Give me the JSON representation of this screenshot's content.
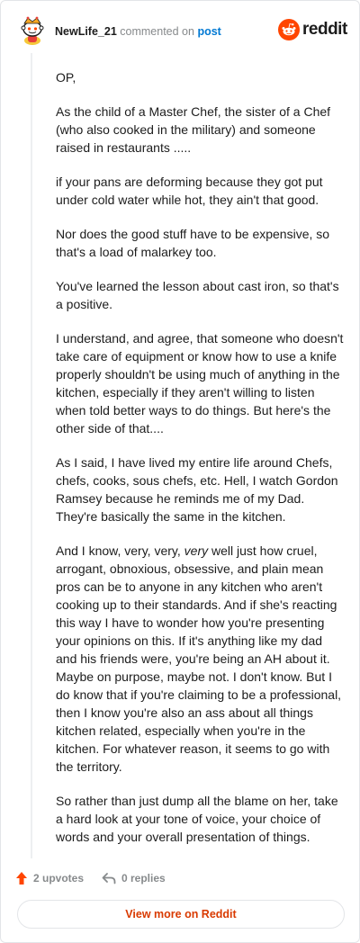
{
  "header": {
    "username": "NewLife_21",
    "commented_text": "commented on",
    "post_link": "post",
    "brand_name": "reddit",
    "avatar_icon": "snoo-avatar-icon",
    "brand_icon": "reddit-logo-icon"
  },
  "comment": {
    "paragraphs": [
      "OP,",
      "As the child of a Master Chef, the sister of a Chef (who also cooked in the military) and someone raised in restaurants .....",
      "if your pans are deforming because they got put under cold water while hot, they ain't that good.",
      "Nor does the good stuff have to be expensive, so that's a load of malarkey too.",
      "You've learned the lesson about cast iron, so that's a positive.",
      "I understand, and agree, that someone who doesn't take care of equipment or know how to use a knife properly shouldn't be using much of anything in the kitchen, especially if they aren't willing to listen when told better ways to do things. But here's the other side of that....",
      "As I said, I have lived my entire life around Chefs, chefs, cooks, sous chefs, etc. Hell, I watch Gordon Ramsey because he reminds me of my Dad. They're basically the same in the kitchen.",
      "So rather than just dump all the blame on her, take a hard look at your tone of voice, your choice of words and your overall presentation of things."
    ],
    "paragraph_8": {
      "before": "And I know, very, very, ",
      "emphasis": "very",
      "after": " well just how cruel, arrogant, obnoxious, obsessive, and plain mean pros can be to anyone in any kitchen who aren't cooking up to their standards. And if she's reacting this way I have to wonder how you're presenting your opinions on this. If it's anything like my dad and his friends were, you're being an AH about it. Maybe on purpose, maybe not. I don't know. But I do know that if you're claiming to be a professional, then I know you're also an ass about all things kitchen related, especially when you're in the kitchen. For whatever reason, it seems to go with the territory."
    }
  },
  "footer": {
    "upvotes": "2 upvotes",
    "replies": "0 replies",
    "upvote_icon": "upvote-arrow-icon",
    "reply_icon": "reply-arrow-icon",
    "view_more": "View more on Reddit"
  },
  "colors": {
    "brand_orange": "#ff4500",
    "link_blue": "#0079d3",
    "muted_gray": "#878a8c",
    "cta_text": "#d93a00"
  }
}
